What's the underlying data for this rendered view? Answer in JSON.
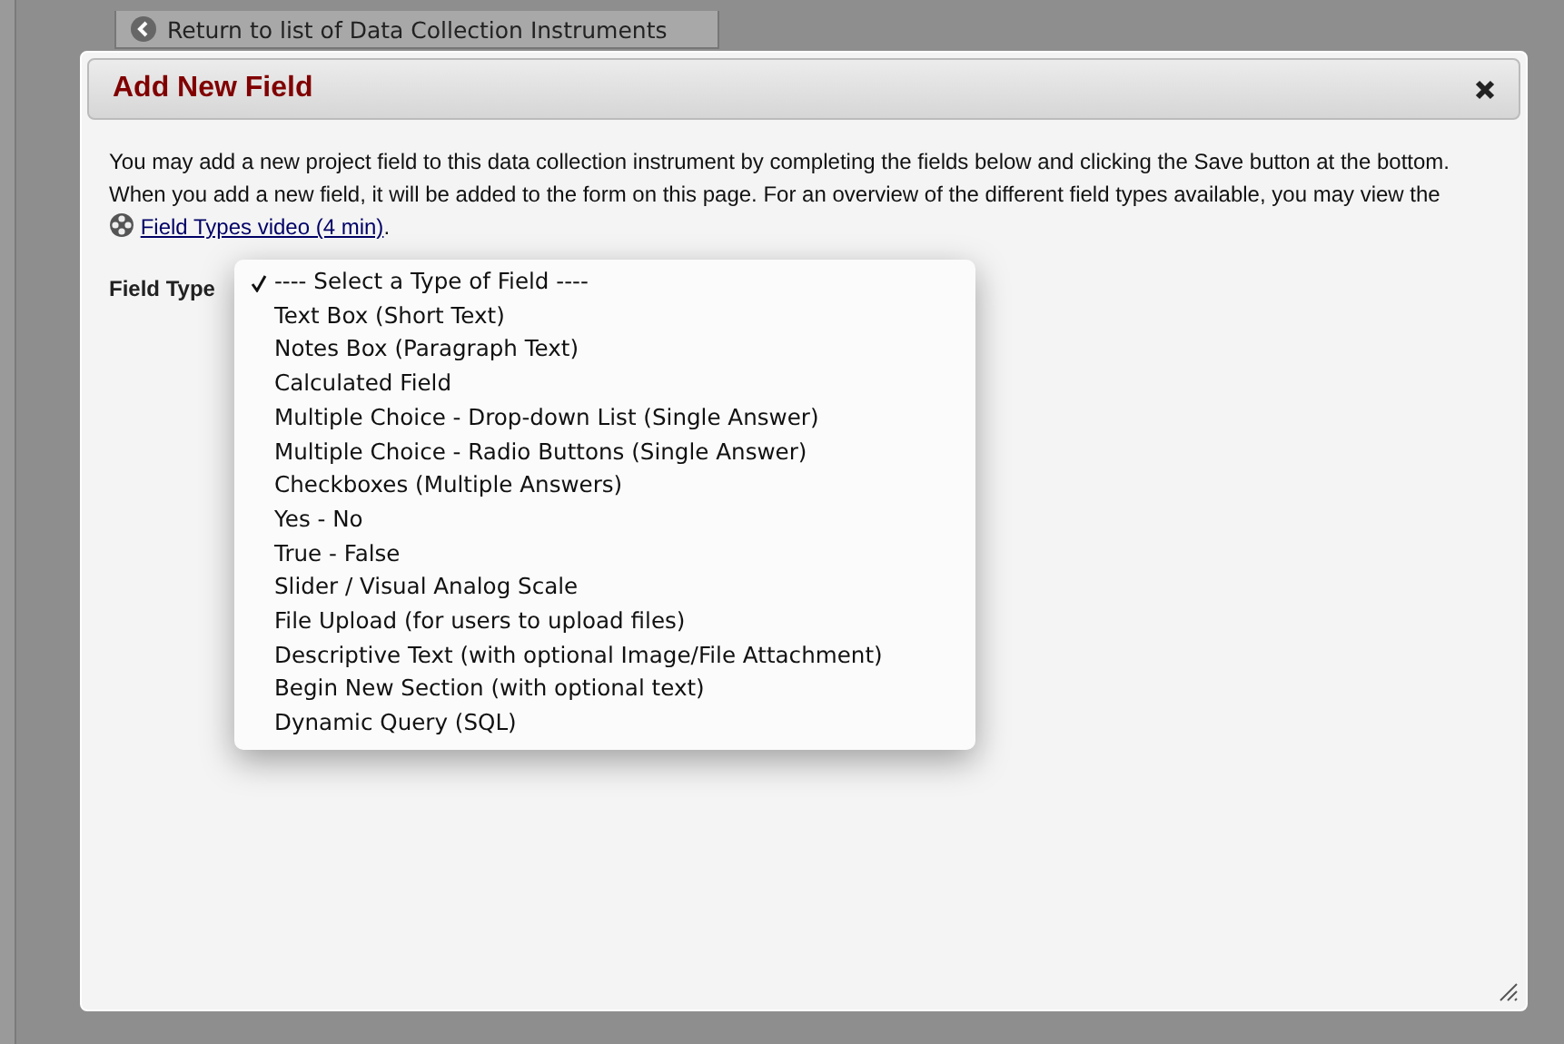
{
  "back_link": {
    "label": "Return to list of Data Collection Instruments"
  },
  "dialog": {
    "title": "Add New Field",
    "intro": {
      "text_before": "You may add a new project field to this data collection instrument by completing the fields below and clicking the Save button at the bottom. When you add a new field, it will be added to the form on this page. For an overview of the different field types available, you may view the",
      "link": "Field Types video (4 min)",
      "text_after": "."
    },
    "field_type": {
      "label": "Field Type",
      "options": [
        {
          "label": "---- Select a Type of Field ----",
          "selected": true
        },
        {
          "label": "Text Box (Short Text)",
          "selected": false
        },
        {
          "label": "Notes Box (Paragraph Text)",
          "selected": false
        },
        {
          "label": "Calculated Field",
          "selected": false
        },
        {
          "label": "Multiple Choice - Drop-down List (Single Answer)",
          "selected": false
        },
        {
          "label": "Multiple Choice - Radio Buttons (Single Answer)",
          "selected": false
        },
        {
          "label": "Checkboxes (Multiple Answers)",
          "selected": false
        },
        {
          "label": "Yes - No",
          "selected": false
        },
        {
          "label": "True - False",
          "selected": false
        },
        {
          "label": "Slider / Visual Analog Scale",
          "selected": false
        },
        {
          "label": "File Upload (for users to upload files)",
          "selected": false
        },
        {
          "label": "Descriptive Text (with optional Image/File Attachment)",
          "selected": false
        },
        {
          "label": "Begin New Section (with optional text)",
          "selected": false
        },
        {
          "label": "Dynamic Query (SQL)",
          "selected": false
        }
      ]
    }
  }
}
